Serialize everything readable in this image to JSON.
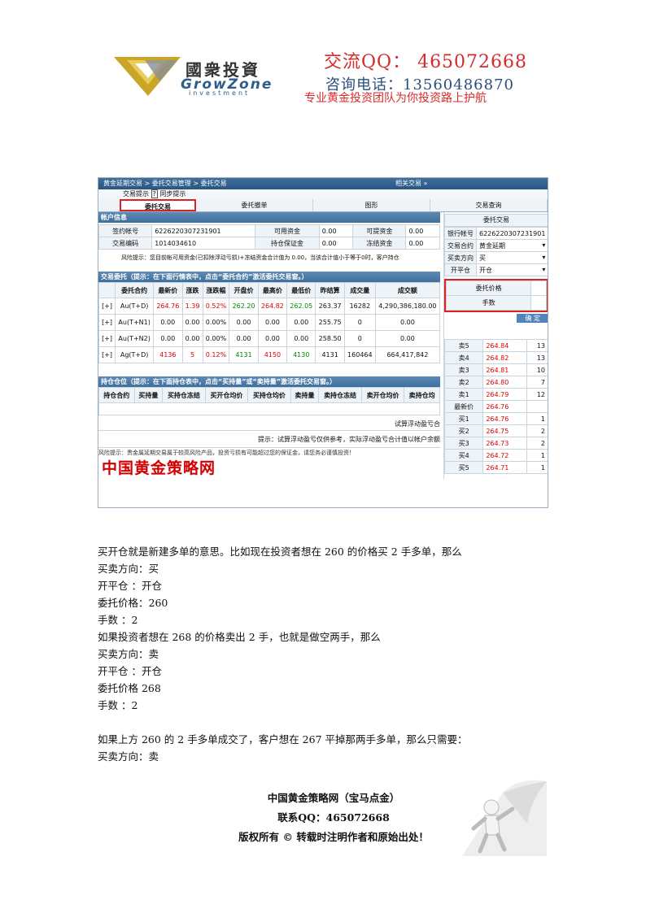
{
  "header": {
    "logo_cn": "國衆投資",
    "logo_en": "GrowZone",
    "logo_sub": "investment",
    "qq": "交流QQ： 465072668",
    "tel": "咨询电话：13560486870",
    "slogan": "专业黄金投资团队为你投资路上护航"
  },
  "screenshot": {
    "breadcrumb": "黄金延期交易 > 委托交易管理 > 委托交易",
    "related": "相关交易 »",
    "tips_link": "交易提示",
    "sync_link": "同步提示",
    "tabs": [
      "委托交易",
      "委托撤单",
      "图形",
      "交易查询"
    ],
    "account_title": "帐户信息",
    "account": {
      "sign_label": "签约帐号",
      "sign_value": "6226220307231901",
      "avail_label": "可用资金",
      "avail_value": "0.00",
      "withdraw_label": "可提资金",
      "withdraw_value": "0.00",
      "code_label": "交易编码",
      "code_value": "1014034610",
      "margin_label": "持仓保证金",
      "margin_value": "0.00",
      "frozen_label": "冻结资金",
      "frozen_value": "0.00",
      "risk": "风险提示：您目前帐可用资金(已扣除浮动亏损)+冻结资金合计值为 0.00，当该合计值小于等于0时，客户持仓"
    },
    "market_title": "交易委托（提示：在下面行情表中，点击“委托合约”激活委托交易窗。）",
    "market_headers": [
      "",
      "委托合约",
      "最新价",
      "涨跌",
      "涨跌幅",
      "开盘价",
      "最高价",
      "最低价",
      "昨结算",
      "成交量",
      "成交额"
    ],
    "market_rows": [
      [
        "[+]",
        "Au(T+D)",
        "264.76",
        "1.39",
        "0.52%",
        "262.20",
        "264.82",
        "262.05",
        "263.37",
        "16282",
        "4,290,386,180.00"
      ],
      [
        "[+]",
        "Au(T+N1)",
        "0.00",
        "0.00",
        "0.00%",
        "0.00",
        "0.00",
        "0.00",
        "255.75",
        "0",
        "0.00"
      ],
      [
        "[+]",
        "Au(T+N2)",
        "0.00",
        "0.00",
        "0.00%",
        "0.00",
        "0.00",
        "0.00",
        "258.50",
        "0",
        "0.00"
      ],
      [
        "[+]",
        "Ag(T+D)",
        "4136",
        "5",
        "0.12%",
        "4131",
        "4150",
        "4130",
        "4131",
        "160464",
        "664,417,842"
      ]
    ],
    "position_title": "持仓仓位（提示：在下面持仓表中，点击“买持量”或“卖持量”激活委托交易窗。）",
    "position_headers": [
      "持仓合约",
      "买持量",
      "买持仓冻结",
      "买开仓均价",
      "买持仓均价",
      "卖持量",
      "卖持仓冻结",
      "卖开仓均价",
      "卖持仓均"
    ],
    "pnl_note": "试算浮动盈亏合",
    "pnl_tip": "提示：试算浮动盈亏仅供参考，实际浮动盈亏合计值以帐户余额",
    "risk_footer": "风险提示：贵金属延期交易属于较高风险产品，投资亏损有可能超过您的保证金，请您务必谨慎投资！",
    "banner": "中国黄金策略网",
    "order": {
      "title": "委托交易",
      "bank_label": "银行帐号",
      "bank_value": "6226220307231901",
      "contract_label": "交易合约",
      "contract_value": "黄金延期",
      "direction_label": "买卖方向",
      "direction_value": "买",
      "open_label": "开平仓",
      "open_value": "开仓",
      "price_label": "委托价格",
      "price_value": "",
      "qty_label": "手数",
      "qty_value": "",
      "confirm": "确 定"
    },
    "quotes": [
      [
        "卖5",
        "264.84",
        "13"
      ],
      [
        "卖4",
        "264.82",
        "13"
      ],
      [
        "卖3",
        "264.81",
        "10"
      ],
      [
        "卖2",
        "264.80",
        "7"
      ],
      [
        "卖1",
        "264.79",
        "12"
      ],
      [
        "最新价",
        "264.76",
        ""
      ],
      [
        "买1",
        "264.76",
        "1"
      ],
      [
        "买2",
        "264.75",
        "2"
      ],
      [
        "买3",
        "264.73",
        "2"
      ],
      [
        "买4",
        "264.72",
        "1"
      ],
      [
        "买5",
        "264.71",
        "1"
      ]
    ]
  },
  "body": {
    "p1": "买开仓就是新建多单的意思。比如现在投资者想在 260 的价格买 2 手多单，那么",
    "l1": "买卖方向：买",
    "l2": "开平仓 ：开仓",
    "l3": "委托价格：260",
    "l4": "手数 ：2",
    "p2": "如果投资者想在 268 的价格卖出 2 手，也就是做空两手，那么",
    "l5": "买卖方向：卖",
    "l6": "开平仓 ：开仓",
    "l7": "委托价格 268",
    "l8": "手数 ：2",
    "p3": "如果上方 260 的 2 手多单成交了，客户想在 267 平掉那两手多单，那么只需要：",
    "l9": "买卖方向：卖"
  },
  "footer": {
    "line1": "中国黄金策略网（宝马点金）",
    "line2": "联系QQ：465072668",
    "line3": "版权所有 © 转载时注明作者和原始出处！"
  }
}
